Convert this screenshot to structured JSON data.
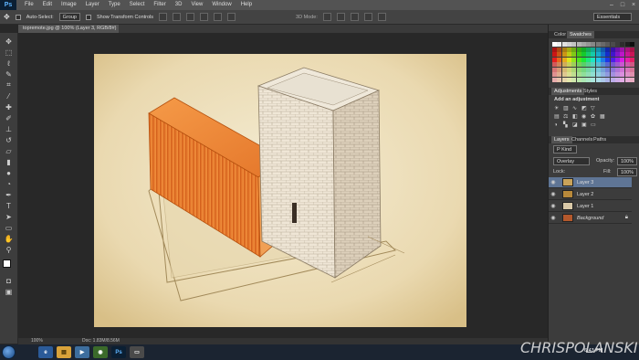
{
  "app": {
    "logo": "Ps"
  },
  "menu": {
    "items": [
      "File",
      "Edit",
      "Image",
      "Layer",
      "Type",
      "Select",
      "Filter",
      "3D",
      "View",
      "Window",
      "Help"
    ]
  },
  "options": {
    "auto_select_label": "Auto-Select:",
    "auto_select_value": "Group",
    "transform_label": "Show Transform Controls",
    "mode_label": "3D Mode:",
    "workspace": "Essentials"
  },
  "document": {
    "tab_title": "topremote.jpg @ 100% (Layer 3, RGB/8#) *"
  },
  "status": {
    "zoom": "100%",
    "doc": "Doc: 1.83M/8.56M"
  },
  "panels": {
    "color_tabs": [
      "Color",
      "Swatches"
    ],
    "adj_tabs": [
      "Adjustments",
      "Styles"
    ],
    "adj_title": "Add an adjustment",
    "layer_tabs": [
      "Layers",
      "Channels",
      "Paths"
    ],
    "kind_label": "P Kind",
    "blend_mode": "Overlay",
    "opacity_label": "Opacity:",
    "opacity_value": "100%",
    "lock_label": "Lock:",
    "fill_label": "Fill:",
    "fill_value": "100%",
    "layers": [
      {
        "name": "Layer 3",
        "selected": true,
        "thumb_color": "#c9a35a"
      },
      {
        "name": "Layer 2",
        "selected": false,
        "thumb_color": "#b8893a"
      },
      {
        "name": "Layer 1",
        "selected": false,
        "thumb_color": "#d9c9a8"
      },
      {
        "name": "Background",
        "selected": false,
        "thumb_color": "#b3582c"
      }
    ]
  },
  "taskbar": {
    "clock": "6:43 PM"
  },
  "watermark": {
    "text": "CHRISPOLANSKI"
  },
  "colors": {
    "accent": "#5f7595",
    "canvas_bg": "#efe3c3",
    "container": "#e8772e"
  }
}
